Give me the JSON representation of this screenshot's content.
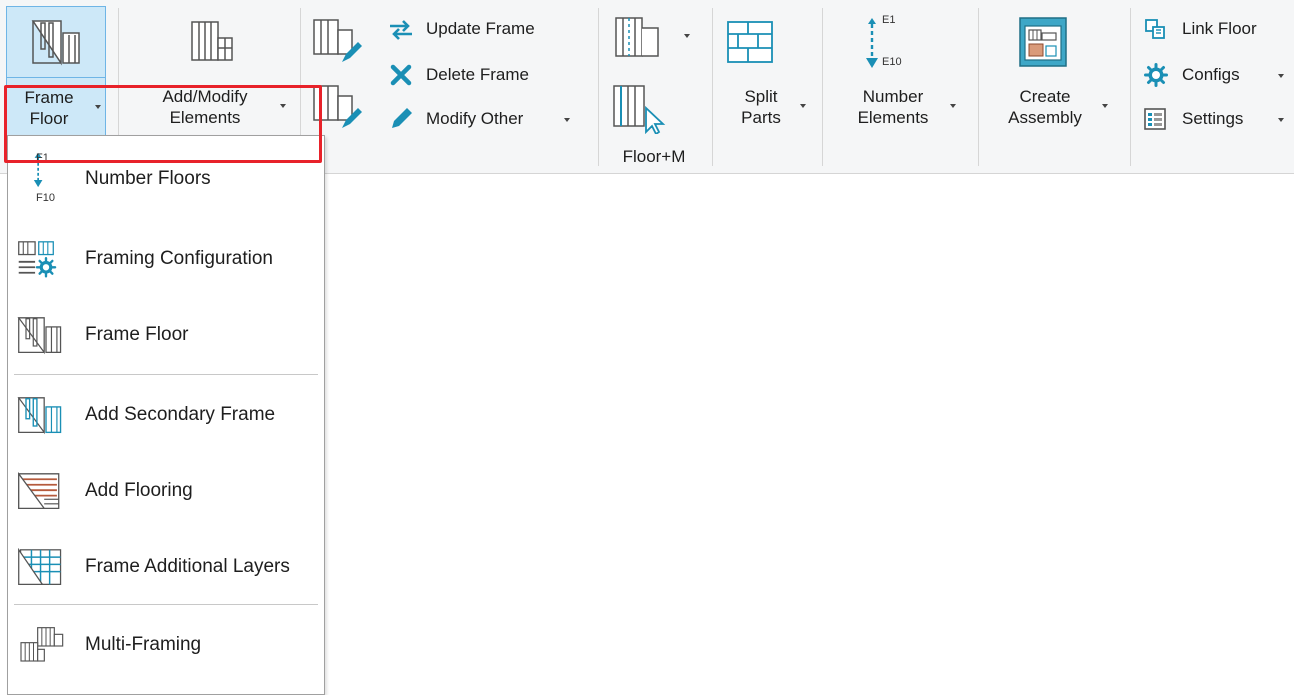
{
  "ribbon": {
    "frame_floor": {
      "line1": "Frame",
      "line2": "Floor"
    },
    "add_modify": {
      "line1": "Add/Modify",
      "line2": "Elements"
    },
    "update_frame": "Update Frame",
    "delete_frame": "Delete Frame",
    "modify_other": "Modify Other",
    "panel_title": "Floor+M",
    "split_parts": {
      "line1": "Split",
      "line2": "Parts"
    },
    "number_elements": {
      "line1": "Number",
      "line2": "Elements",
      "tag_top": "E1",
      "tag_bottom": "E10"
    },
    "create_assembly": {
      "line1": "Create",
      "line2": "Assembly"
    },
    "link_floor": "Link Floor",
    "configs": "Configs",
    "settings": "Settings"
  },
  "menu": {
    "items": [
      {
        "label": "Number Floors",
        "icon": "number-floors-icon",
        "tag_top": "F1",
        "tag_bottom": "F10"
      },
      {
        "label": "Framing Configuration",
        "icon": "framing-configuration-icon"
      },
      {
        "label": "Frame Floor",
        "icon": "frame-floor-icon"
      },
      {
        "label": "Add Secondary Frame",
        "icon": "add-secondary-frame-icon"
      },
      {
        "label": "Add Flooring",
        "icon": "add-flooring-icon"
      },
      {
        "label": "Frame Additional Layers",
        "icon": "frame-additional-layers-icon"
      },
      {
        "label": "Multi-Framing",
        "icon": "multi-framing-icon"
      }
    ]
  },
  "colors": {
    "accent": "#1a8fb5",
    "highlight": "#e8222a",
    "selected_bg": "#cde8f8",
    "brick": "#b55a3c"
  }
}
